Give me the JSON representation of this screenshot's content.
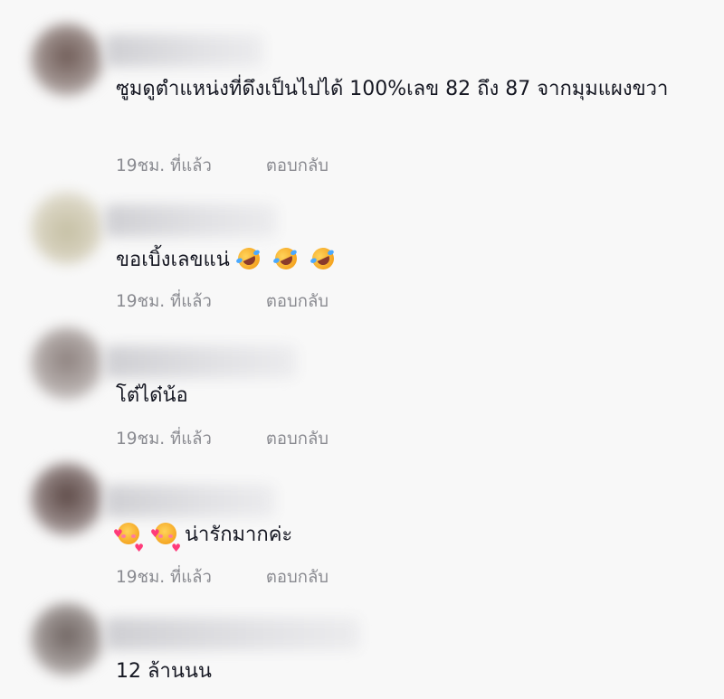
{
  "comments": [
    {
      "text": "ซูมดูตำแหน่งที่ดึงเป็นไปได้ 100%เลข 82 ถึง 87 จากมุมแผงขวา",
      "time": "19ชม. ที่แล้ว",
      "reply": "ตอบกลับ"
    },
    {
      "text": "ขอเบิ้งเลขแน่",
      "emojis_after": [
        "rolling-on-floor-laughing",
        "rolling-on-floor-laughing",
        "rolling-on-floor-laughing"
      ],
      "time": "19ชม. ที่แล้ว",
      "reply": "ตอบกลับ"
    },
    {
      "text": "โต๋ได๋น้อ",
      "time": "19ชม. ที่แล้ว",
      "reply": "ตอบกลับ"
    },
    {
      "emojis_before": [
        "smiling-face-with-hearts",
        "smiling-face-with-hearts"
      ],
      "text": "น่ารักมากค่ะ",
      "time": "19ชม. ที่แล้ว",
      "reply": "ตอบกลับ"
    },
    {
      "text": "12 ล้านนน"
    }
  ],
  "colors": {
    "background": "#f8f8f8",
    "text": "#161823",
    "meta": "#8a8b91"
  }
}
